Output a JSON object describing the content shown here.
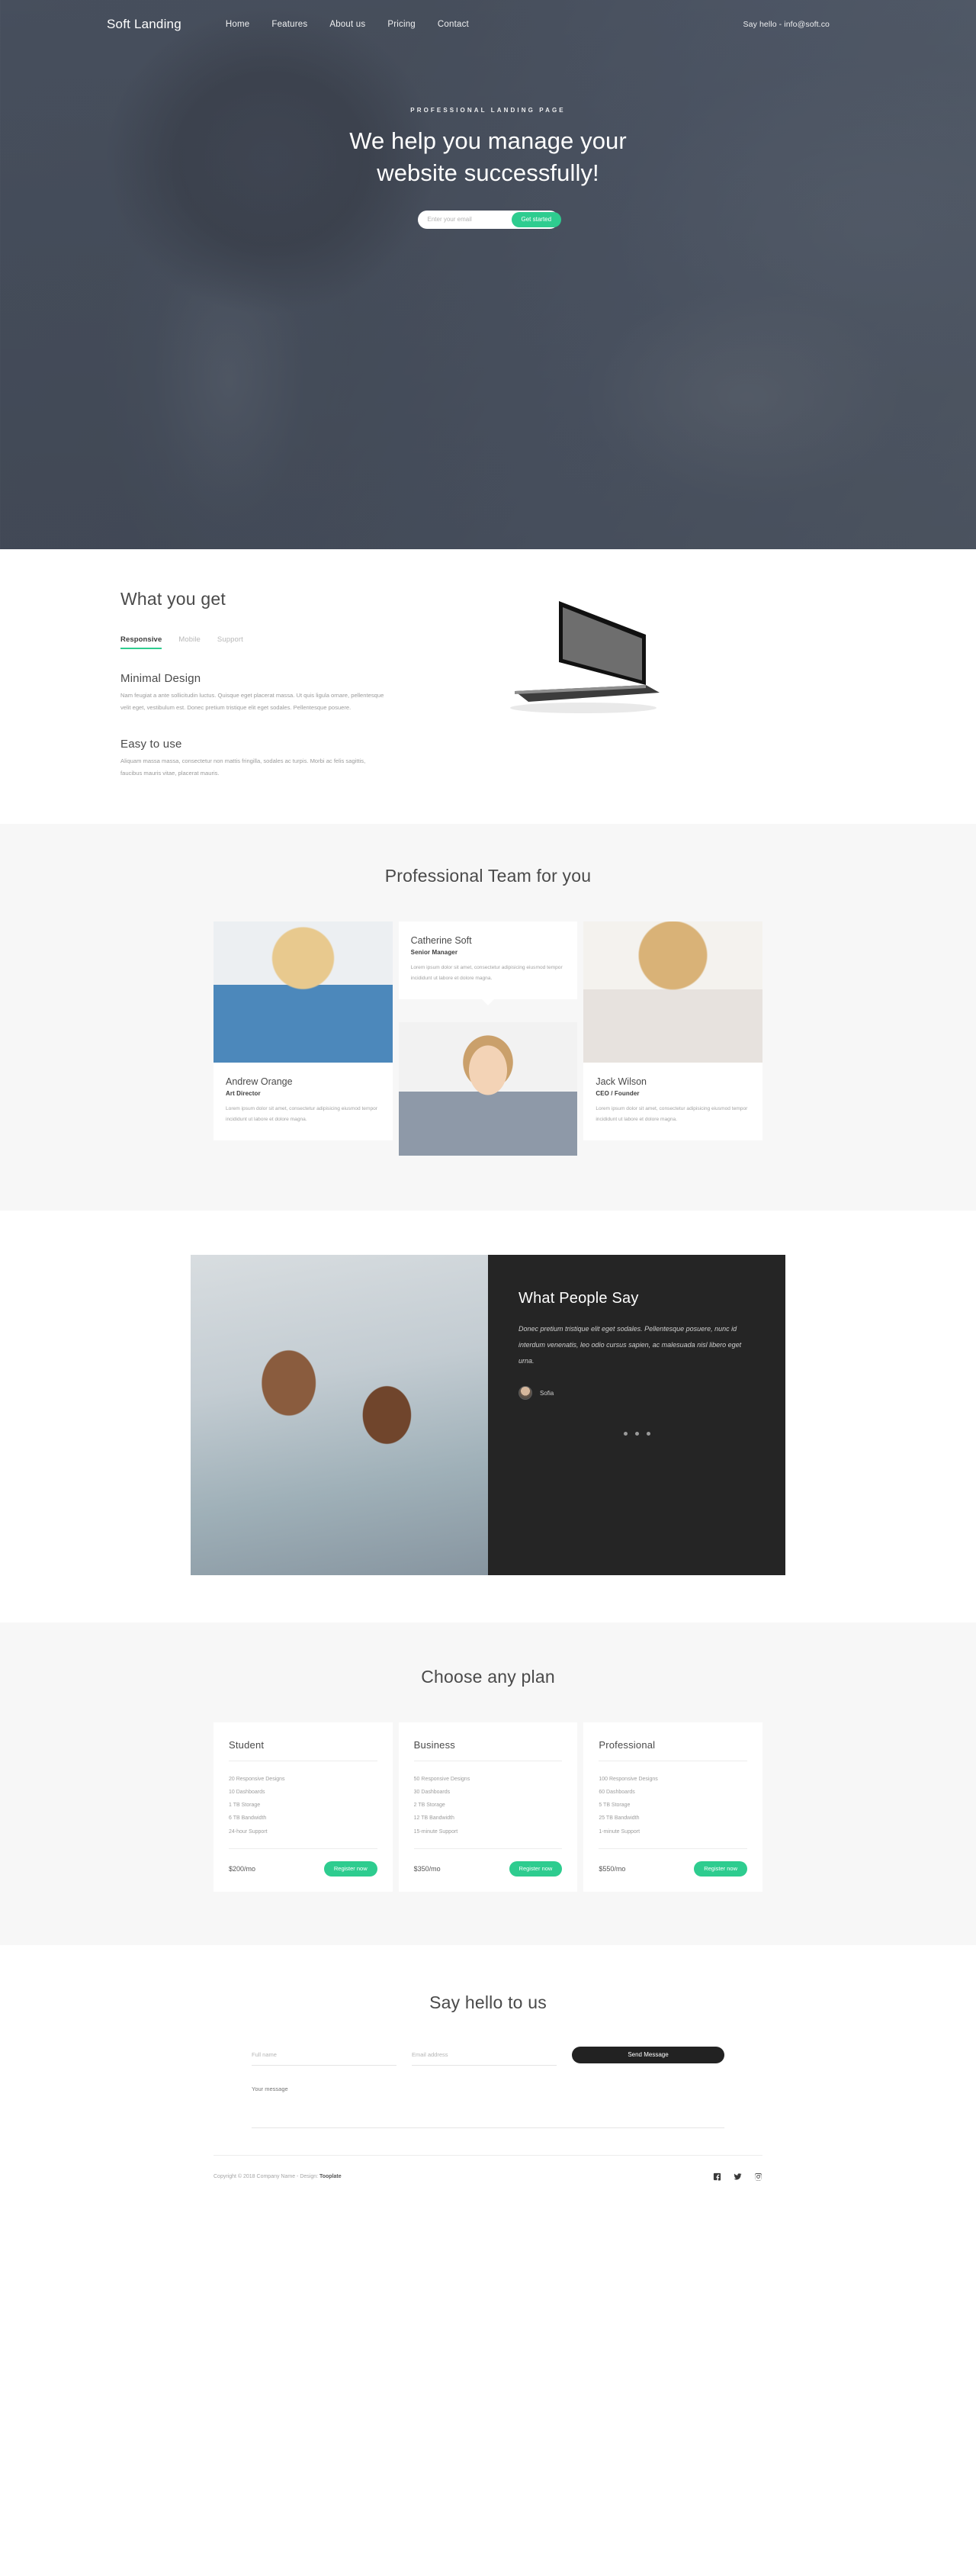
{
  "brand": "Soft Landing",
  "nav": {
    "links": [
      "Home",
      "Features",
      "About us",
      "Pricing",
      "Contact"
    ],
    "contact": "Say hello - info@soft.co"
  },
  "hero": {
    "eyebrow": "PROFESSIONAL LANDING PAGE",
    "title_line1": "We help you manage your",
    "title_line2": "website successfully!",
    "email_placeholder": "Enter your email",
    "cta": "Get started"
  },
  "features": {
    "heading": "What you get",
    "tabs": [
      "Responsive",
      "Mobile",
      "Support"
    ],
    "active_tab": "Responsive",
    "blocks": [
      {
        "title": "Minimal Design",
        "text": "Nam feugiat a ante sollicitudin luctus. Quisque eget placerat massa. Ut quis ligula ornare, pellentesque velit eget, vestibulum est. Donec pretium tristique elit eget sodales. Pellentesque posuere."
      },
      {
        "title": "Easy to use",
        "text": "Aliquam massa massa, consectetur non mattis fringilla, sodales ac turpis. Morbi ac felis sagittis, faucibus mauris vitae, placerat mauris."
      }
    ]
  },
  "team": {
    "heading": "Professional Team for you",
    "members": [
      {
        "name": "Andrew Orange",
        "role": "Art Director",
        "text": "Lorem ipsum dolor sit amet, consectetur adipisicing eiusmod tempor incididunt ut labore et dolore magna."
      },
      {
        "name": "Catherine Soft",
        "role": "Senior Manager",
        "text": "Lorem ipsum dolor sit amet, consectetur adipisicing eiusmod tempor incididunt ut labore et dolore magna."
      },
      {
        "name": "Jack Wilson",
        "role": "CEO / Founder",
        "text": "Lorem ipsum dolor sit amet, consectetur adipisicing eiusmod tempor incididunt ut labore et dolore magna."
      }
    ]
  },
  "testimonial": {
    "heading": "What People Say",
    "quote": "Donec pretium tristique elit eget sodales. Pellentesque posuere, nunc id interdum venenatis, leo odio cursus sapien, ac malesuada nisl libero eget urna.",
    "author": "Sofia",
    "dots": 3
  },
  "pricing": {
    "heading": "Choose any plan",
    "plans": [
      {
        "name": "Student",
        "features": [
          "20 Responsive Designs",
          "10 Dashboards",
          "1 TB Storage",
          "6 TB Bandwidth",
          "24-hour Support"
        ],
        "price": "$200/mo",
        "cta": "Register now"
      },
      {
        "name": "Business",
        "features": [
          "50 Responsive Designs",
          "30 Dashboards",
          "2 TB Storage",
          "12 TB Bandwidth",
          "15-minute Support"
        ],
        "price": "$350/mo",
        "cta": "Register now"
      },
      {
        "name": "Professional",
        "features": [
          "100 Responsive Designs",
          "60 Dashboards",
          "5 TB Storage",
          "25 TB Bandwidth",
          "1-minute Support"
        ],
        "price": "$550/mo",
        "cta": "Register now"
      }
    ]
  },
  "contact": {
    "heading": "Say hello to us",
    "name_placeholder": "Full name",
    "email_placeholder": "Email address",
    "message_placeholder": "Your message",
    "submit": "Send Message"
  },
  "footer": {
    "copyright_prefix": "Copyright © 2018 Company Name - Design: ",
    "designer": "Tooplate",
    "socials": [
      "facebook-icon",
      "twitter-icon",
      "instagram-icon"
    ]
  },
  "colors": {
    "accent_green": "#2ecc8f",
    "dark_panel": "#252525",
    "light_section": "#f7f7f7"
  }
}
